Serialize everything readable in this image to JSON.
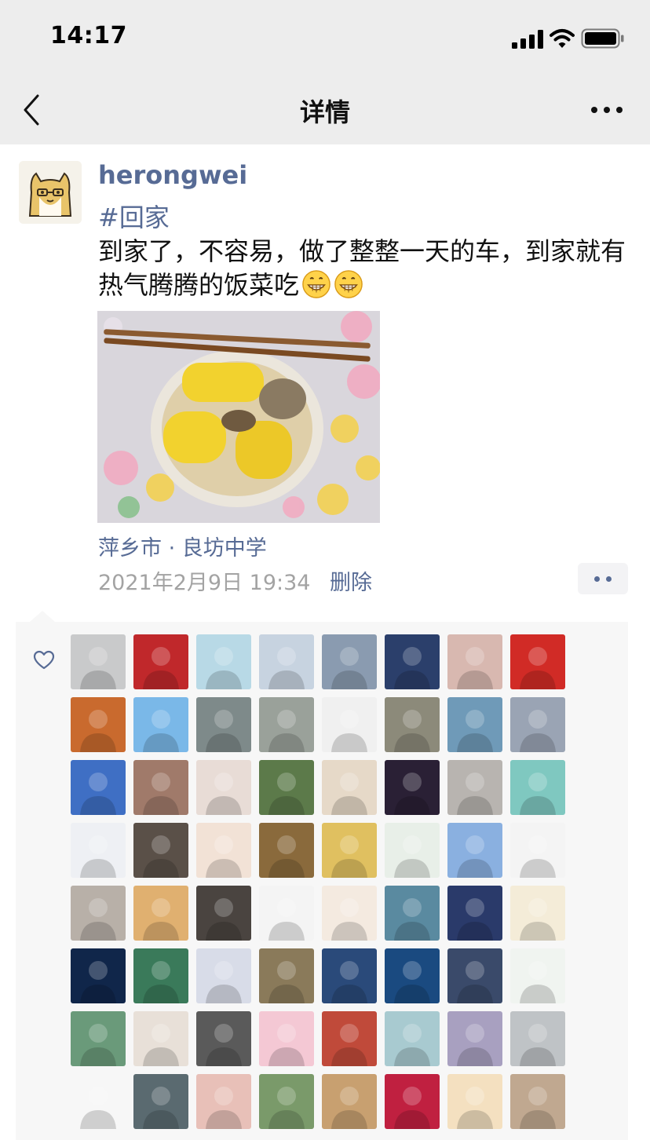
{
  "status_bar": {
    "time": "14:17"
  },
  "nav": {
    "title": "详情",
    "back_icon": "chevron-left-icon",
    "more_icon": "more-dots-icon"
  },
  "post": {
    "username": "herongwei",
    "hashtag": "#回家",
    "text": "到家了，不容易，做了整整一天的车，到家就有热气腾腾的饭菜吃",
    "emoji": [
      "grinning-emoji",
      "grinning-emoji"
    ],
    "photo": "bowl-of-corn-soup-photo",
    "location": "萍乡市 · 良坊中学",
    "timestamp": "2021年2月9日 19:34",
    "delete_label": "删除",
    "action_icon": "more-dots-icon"
  },
  "likes": {
    "icon": "heart-outline-icon",
    "colors": [
      [
        "#c9cacb",
        "#c0282b",
        "#b8d9e6",
        "#c7d3e0",
        "#8a9bb0",
        "#2b3f6b",
        "#d8b8b0",
        "#d12b26"
      ],
      [
        "#c96a2e",
        "#7ab8e8",
        "#7e8a8a",
        "#9aa19a",
        "#f0f0f0",
        "#8c8a7a",
        "#6f9ab8",
        "#9aa4b4"
      ],
      [
        "#3f6fc4",
        "#a07a6a",
        "#e8dcd6",
        "#5c7a4a",
        "#e6d9c8",
        "#2a2035",
        "#b8b4b0",
        "#7fc8c0"
      ],
      [
        "#eef0f4",
        "#5a5048",
        "#f2e2d6",
        "#8a6a3c",
        "#e0c060",
        "#e8efe8",
        "#8ab0e0",
        "#f4f4f4"
      ],
      [
        "#b8b0a8",
        "#e0b070",
        "#4a4440",
        "#f4f4f4",
        "#f4eae0",
        "#5a8aa0",
        "#2a3a6a",
        "#f4ecd8"
      ],
      [
        "#10264a",
        "#3a7a5a",
        "#d8dce8",
        "#8a7a5a",
        "#2a4a7a",
        "#1a4a80",
        "#3a4a6a",
        "#f0f4f0"
      ],
      [
        "#6a9a7a",
        "#e8e0d8",
        "#5a5a5a",
        "#f4c8d4",
        "#c04a3a",
        "#a8cad0",
        "#a8a0c0",
        "#bfc3c6"
      ],
      [
        "#f7f7f7",
        "#5a6a70",
        "#e8c0b8",
        "#7a9a6a",
        "#c8a070",
        "#c02040",
        "#f4e0c0",
        "#c0a890"
      ]
    ]
  }
}
